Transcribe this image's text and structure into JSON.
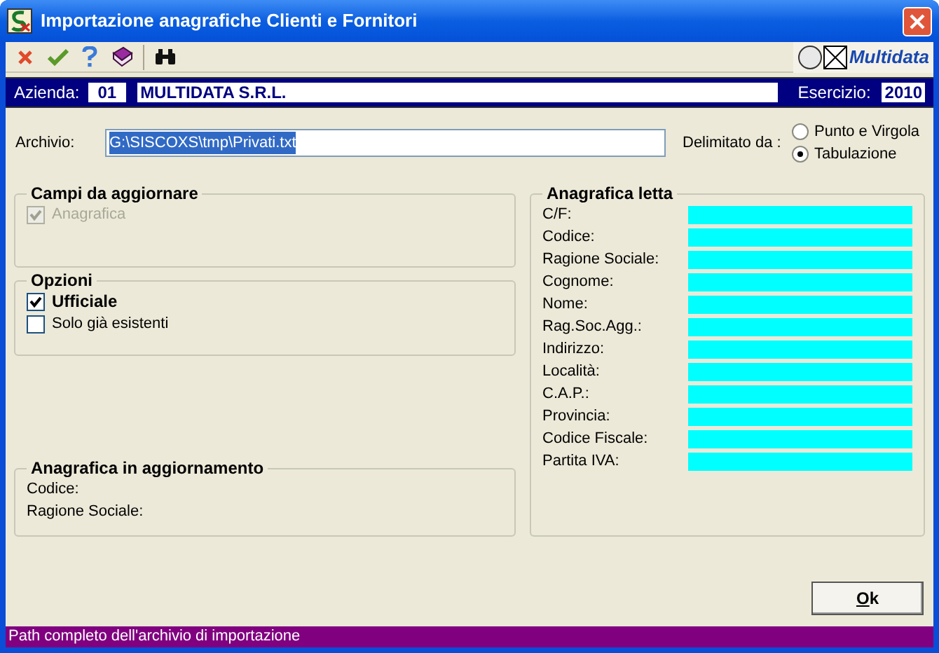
{
  "window": {
    "title": "Importazione anagrafiche Clienti e Fornitori"
  },
  "toolbar": {
    "logo_text": "Multidata"
  },
  "company_bar": {
    "azienda_label": "Azienda:",
    "azienda_code": "01",
    "azienda_name": "MULTIDATA S.R.L.",
    "esercizio_label": "Esercizio:",
    "esercizio_value": "2010"
  },
  "archivio": {
    "label": "Archivio:",
    "value": "G:\\SISCOXS\\tmp\\Privati.txt",
    "text_selected": true
  },
  "delimiter": {
    "label": "Delimitato da :",
    "options": [
      {
        "label": "Punto e Virgola",
        "selected": false
      },
      {
        "label": "Tabulazione",
        "selected": true
      }
    ]
  },
  "campi": {
    "title": "Campi da aggiornare",
    "items": [
      {
        "label": "Anagrafica",
        "checked": true,
        "disabled": true,
        "bold": false
      }
    ]
  },
  "opzioni": {
    "title": "Opzioni",
    "items": [
      {
        "label": "Ufficiale",
        "checked": true,
        "disabled": false,
        "bold": true
      },
      {
        "label": "Solo già esistenti",
        "checked": false,
        "disabled": false,
        "bold": false
      }
    ]
  },
  "aggiornamento": {
    "title": "Anagrafica in aggiornamento",
    "fields": [
      "Codice:",
      "Ragione Sociale:"
    ]
  },
  "letta": {
    "title": "Anagrafica letta",
    "fields": [
      "C/F:",
      "Codice:",
      "Ragione Sociale:",
      "Cognome:",
      "Nome:",
      "Rag.Soc.Agg.:",
      "Indirizzo:",
      "Località:",
      "C.A.P.:",
      "Provincia:",
      "Codice Fiscale:",
      "Partita IVA:"
    ]
  },
  "ok_button": {
    "label": "Ok"
  },
  "status_bar": "Path completo dell'archivio di importazione"
}
